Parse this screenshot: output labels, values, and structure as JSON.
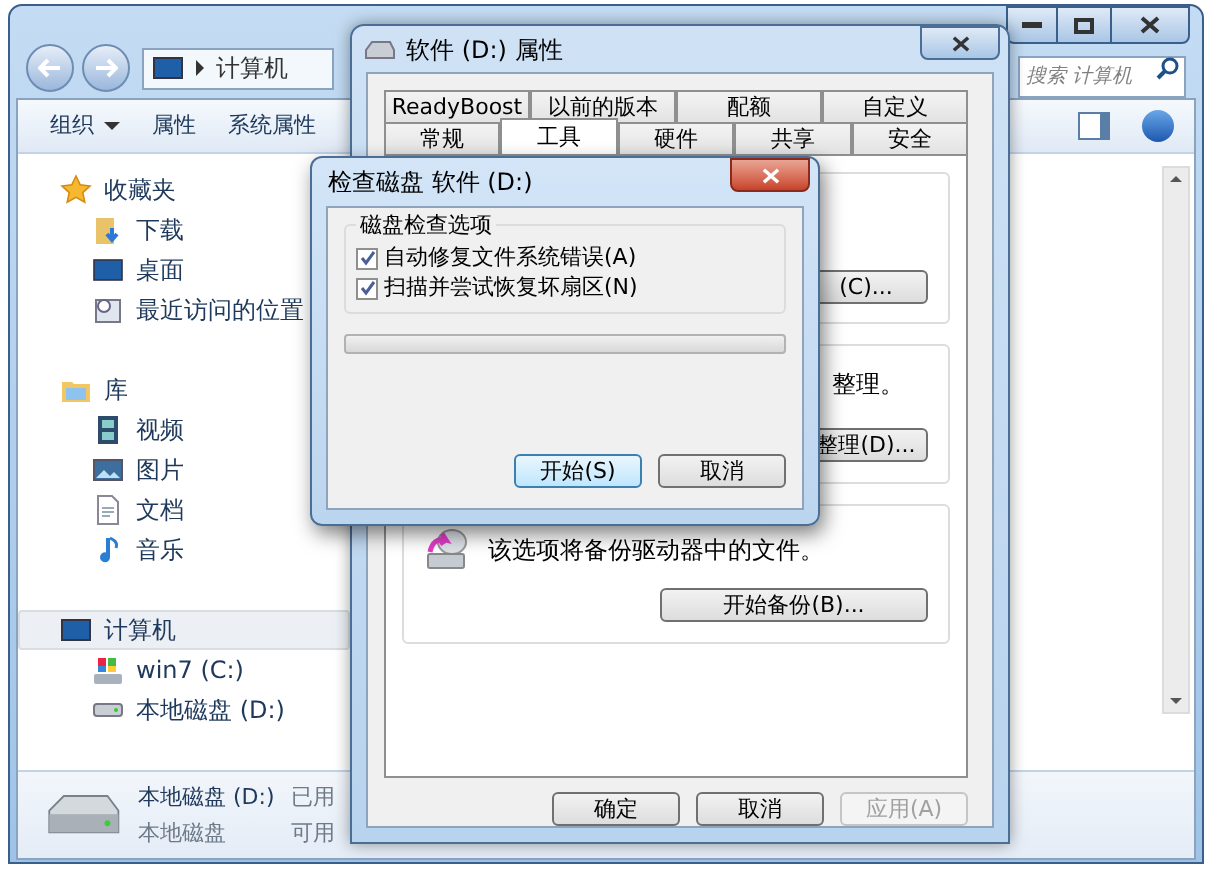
{
  "explorer": {
    "address": [
      "计算机"
    ],
    "search": {
      "placeholder": "搜索 计算机"
    },
    "toolbar": [
      {
        "label": "组织",
        "kind": "menu"
      },
      {
        "label": "属性",
        "kind": "plain"
      },
      {
        "label": "系统属性",
        "kind": "plain"
      }
    ],
    "sidebar": [
      {
        "label": "收藏夹",
        "kind": "favorites",
        "selected": false,
        "children": [
          {
            "label": "下载",
            "kind": "download",
            "selected": false
          },
          {
            "label": "桌面",
            "kind": "desktop",
            "selected": false
          },
          {
            "label": "最近访问的位置",
            "kind": "recent",
            "selected": false
          }
        ]
      },
      {
        "label": "库",
        "kind": "library",
        "selected": false,
        "children": [
          {
            "label": "视频",
            "kind": "video",
            "selected": false
          },
          {
            "label": "图片",
            "kind": "picture",
            "selected": false
          },
          {
            "label": "文档",
            "kind": "document",
            "selected": false
          },
          {
            "label": "音乐",
            "kind": "music",
            "selected": false
          }
        ]
      },
      {
        "label": "计算机",
        "kind": "computer",
        "selected": true,
        "children": [
          {
            "label": "win7 (C:)",
            "kind": "system",
            "selected": false
          },
          {
            "label": "本地磁盘 (D:)",
            "kind": "drive",
            "selected": false
          }
        ]
      }
    ],
    "details": {
      "name": "本地磁盘 (D:)",
      "type": "本地磁盘",
      "used": "已用",
      "free": "可用"
    }
  },
  "properties": {
    "title": "软件 (D:) 属性",
    "tab_rows": [
      [
        {
          "label": "ReadyBoost",
          "selected": false
        },
        {
          "label": "以前的版本",
          "selected": false
        },
        {
          "label": "配额",
          "selected": false
        },
        {
          "label": "自定义",
          "selected": false
        }
      ],
      [
        {
          "label": "常规",
          "selected": false
        },
        {
          "label": "工具",
          "selected": true
        },
        {
          "label": "硬件",
          "selected": false
        },
        {
          "label": "共享",
          "selected": false
        },
        {
          "label": "安全",
          "selected": false
        }
      ]
    ],
    "groups": [
      {
        "button": "(C)..."
      },
      {
        "text": "整理。",
        "button": "整理(D)..."
      },
      {
        "text": "该选项将备份驱动器中的文件。",
        "button": "开始备份(B)...",
        "kind": "backup"
      }
    ],
    "buttons": [
      {
        "label": "确定",
        "disabled": false
      },
      {
        "label": "取消",
        "disabled": false
      },
      {
        "label": "应用(A)",
        "disabled": true
      }
    ]
  },
  "check_disk": {
    "title": "检查磁盘 软件 (D:)",
    "group_label": "磁盘检查选项",
    "options": [
      {
        "label": "自动修复文件系统错误(A)",
        "checked": true
      },
      {
        "label": "扫描并尝试恢复坏扇区(N)",
        "checked": true
      }
    ],
    "progress": {
      "level": 0
    },
    "buttons": [
      {
        "label": "开始(S)",
        "default": true
      },
      {
        "label": "取消",
        "default": false
      }
    ]
  }
}
